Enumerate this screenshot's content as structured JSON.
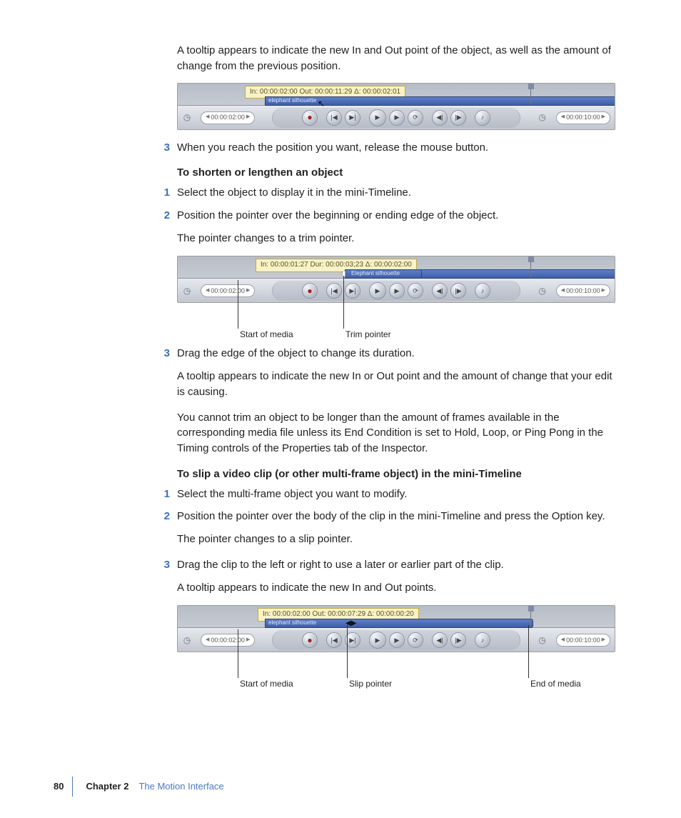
{
  "intro": "A tooltip appears to indicate the new In and Out point of the object, as well as the amount of change from the previous position.",
  "fig1": {
    "tooltip": "In: 00:00:02:00 Out: 00:00:11:29 Δ: 00:00:02:01",
    "clip_label": "elephant silhouette",
    "left_tc": "00:00:02:00",
    "right_tc": "00:00:10:00"
  },
  "step3a": "When you reach the position you want, release the mouse button.",
  "heading1": "To shorten or lengthen an object",
  "s1_1": "Select the object to display it in the mini-Timeline.",
  "s1_2": "Position the pointer over the beginning or ending edge of the object.",
  "s1_2b": "The pointer changes to a trim pointer.",
  "fig2": {
    "tooltip": "In: 00:00:01:27 Dur: 00:00:03;23 Δ: 00:00:02:00",
    "clip_label": "Elephant silhouette",
    "left_tc": "00:00:02:00",
    "right_tc": "00:00:10:00",
    "callout_a": "Start of media",
    "callout_b": "Trim pointer"
  },
  "s1_3": "Drag the edge of the object to change its duration.",
  "s1_3b": "A tooltip appears to indicate the new In or Out point and the amount of change that your edit is causing.",
  "s1_3c": "You cannot trim an object to be longer than the amount of frames available in the corresponding media file unless its End Condition is set to Hold, Loop, or Ping Pong in the Timing controls of the Properties tab of the Inspector.",
  "heading2": "To slip a video clip (or other multi-frame object) in the mini-Timeline",
  "s2_1": "Select the multi-frame object you want to modify.",
  "s2_2": "Position the pointer over the body of the clip in the mini-Timeline and press the Option key.",
  "s2_2b": "The pointer changes to a slip pointer.",
  "s2_3": "Drag the clip to the left or right to use a later or earlier part of the clip.",
  "s2_3b": "A tooltip appears to indicate the new In and Out points.",
  "fig3": {
    "tooltip": "In: 00:00:02:00 Out: 00:00:07:29 Δ: 00:00:00:20",
    "clip_label": "elephant silhouette",
    "left_tc": "00:00:02:00",
    "right_tc": "00:00:10:00",
    "callout_a": "Start of media",
    "callout_b": "Slip pointer",
    "callout_c": "End of media"
  },
  "footer": {
    "page": "80",
    "chapter": "Chapter 2",
    "title": "The Motion Interface"
  },
  "nums": {
    "n1": "1",
    "n2": "2",
    "n3": "3"
  }
}
